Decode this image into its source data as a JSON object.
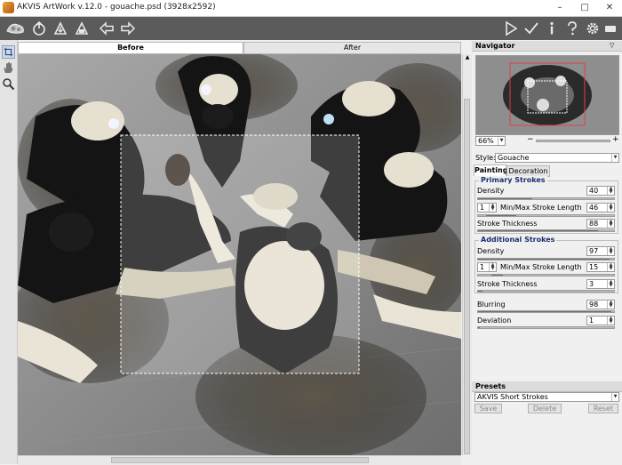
{
  "window": {
    "title": "AKVIS ArtWork v.12.0 - gouache.psd (3928x2592)",
    "minimize_glyph": "–",
    "maximize_glyph": "□",
    "close_glyph": "✕"
  },
  "toolbar": {
    "left_icons": [
      "logo-icon",
      "open-file-icon",
      "save-file-icon",
      "print-icon",
      "undo-icon",
      "redo-icon"
    ],
    "right_icons": [
      "run-icon",
      "apply-icon",
      "info-icon",
      "help-icon",
      "settings-icon",
      "message-icon"
    ]
  },
  "tools": [
    "crop-tool-icon",
    "hand-tool-icon",
    "zoom-tool-icon"
  ],
  "canvas": {
    "tabs": [
      {
        "label": "Before",
        "active": true
      },
      {
        "label": "After",
        "active": false
      }
    ]
  },
  "navigator": {
    "title": "Navigator",
    "zoom": "66%",
    "zoom_out": "−",
    "zoom_in": "+"
  },
  "style": {
    "label": "Style:",
    "value": "Gouache"
  },
  "tabs": [
    {
      "label": "Painting",
      "active": true
    },
    {
      "label": "Decoration",
      "active": false
    }
  ],
  "primary_strokes": {
    "title": "Primary Strokes",
    "density": {
      "label": "Density",
      "value": "40",
      "level": 0.4
    },
    "stroke_length": {
      "label": "Min/Max Stroke Length",
      "min": "1",
      "max": "46"
    },
    "stroke_thickness": {
      "label": "Stroke Thickness",
      "value": "88",
      "level": 0.88
    }
  },
  "additional_strokes": {
    "title": "Additional Strokes",
    "density": {
      "label": "Density",
      "value": "97",
      "level": 0.97
    },
    "stroke_length": {
      "label": "Min/Max Stroke Length",
      "min": "1",
      "max": "15"
    },
    "stroke_thickness": {
      "label": "Stroke Thickness",
      "value": "3",
      "level": 0.03
    }
  },
  "blurring": {
    "label": "Blurring",
    "value": "98",
    "level": 0.98
  },
  "deviation": {
    "label": "Deviation",
    "value": "1",
    "level": 0.01
  },
  "presets": {
    "title": "Presets",
    "selected": "AKVIS Short Strokes",
    "save_label": "Save",
    "delete_label": "Delete",
    "reset_label": "Reset"
  },
  "colors": {
    "toolbar_bg": "#5b5b5b",
    "accent": "#1a2f6e"
  }
}
